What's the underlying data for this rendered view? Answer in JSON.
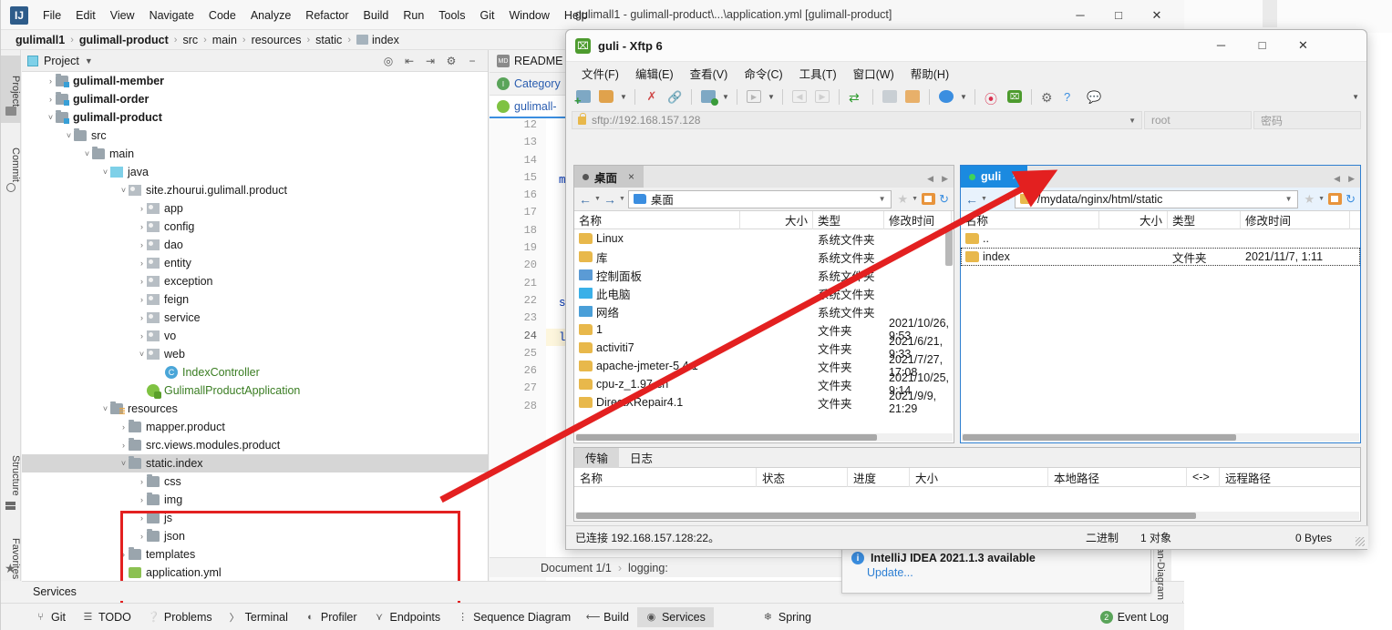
{
  "idea": {
    "title": "gulimall1 - gulimall-product\\...\\application.yml [gulimall-product]",
    "logo": "IJ",
    "window_controls": {
      "minimize": "─",
      "maximize": "□",
      "close": "✕"
    },
    "menu": [
      {
        "label": "File"
      },
      {
        "label": "Edit"
      },
      {
        "label": "View"
      },
      {
        "label": "Navigate"
      },
      {
        "label": "Code"
      },
      {
        "label": "Analyze"
      },
      {
        "label": "Refactor"
      },
      {
        "label": "Build"
      },
      {
        "label": "Run"
      },
      {
        "label": "Tools"
      },
      {
        "label": "Git"
      },
      {
        "label": "Window"
      },
      {
        "label": "Help"
      }
    ],
    "breadcrumb": [
      {
        "label": "gulimall1",
        "bold": true
      },
      {
        "label": "gulimall-product",
        "bold": true
      },
      {
        "label": "src",
        "bold": false
      },
      {
        "label": "main",
        "bold": false
      },
      {
        "label": "resources",
        "bold": false
      },
      {
        "label": "static",
        "bold": false
      },
      {
        "label": "index",
        "bold": false
      }
    ],
    "tool_strip": [
      {
        "label": "Project",
        "icon": "folder-icon"
      },
      {
        "label": "Commit",
        "icon": "commit-icon"
      },
      {
        "label": "Structure",
        "icon": "structure-icon"
      },
      {
        "label": "Favorites",
        "icon": "star-icon"
      }
    ],
    "right_strip": {
      "label": "Bean-Diagram"
    },
    "project_panel": {
      "title": "Project",
      "header_icons": [
        "target-icon",
        "expand-all-icon",
        "collapse-all-icon",
        "gear-icon",
        "hide-icon"
      ],
      "tree": [
        {
          "label": "gulimall-member",
          "indent": 1,
          "arrow": "›",
          "icon": "module-folder",
          "bold": true
        },
        {
          "label": "gulimall-order",
          "indent": 1,
          "arrow": "›",
          "icon": "module-folder",
          "bold": true
        },
        {
          "label": "gulimall-product",
          "indent": 1,
          "arrow": "˅",
          "icon": "module-folder",
          "bold": true
        },
        {
          "label": "src",
          "indent": 2,
          "arrow": "˅",
          "icon": "folder",
          "bold": false
        },
        {
          "label": "main",
          "indent": 3,
          "arrow": "˅",
          "icon": "folder",
          "bold": false
        },
        {
          "label": "java",
          "indent": 4,
          "arrow": "˅",
          "icon": "source-folder",
          "bold": false
        },
        {
          "label": "site.zhourui.gulimall.product",
          "indent": 5,
          "arrow": "˅",
          "icon": "package",
          "bold": false
        },
        {
          "label": "app",
          "indent": 6,
          "arrow": "›",
          "icon": "package",
          "bold": false
        },
        {
          "label": "config",
          "indent": 6,
          "arrow": "›",
          "icon": "package",
          "bold": false
        },
        {
          "label": "dao",
          "indent": 6,
          "arrow": "›",
          "icon": "package",
          "bold": false
        },
        {
          "label": "entity",
          "indent": 6,
          "arrow": "›",
          "icon": "package",
          "bold": false
        },
        {
          "label": "exception",
          "indent": 6,
          "arrow": "›",
          "icon": "package",
          "bold": false
        },
        {
          "label": "feign",
          "indent": 6,
          "arrow": "›",
          "icon": "package",
          "bold": false
        },
        {
          "label": "service",
          "indent": 6,
          "arrow": "›",
          "icon": "package",
          "bold": false
        },
        {
          "label": "vo",
          "indent": 6,
          "arrow": "›",
          "icon": "package",
          "bold": false
        },
        {
          "label": "web",
          "indent": 6,
          "arrow": "˅",
          "icon": "package",
          "bold": false
        },
        {
          "label": "IndexController",
          "indent": 7,
          "arrow": "",
          "icon": "class",
          "bold": false
        },
        {
          "label": "GulimallProductApplication",
          "indent": 6,
          "arrow": "",
          "icon": "spring-class",
          "bold": false
        },
        {
          "label": "resources",
          "indent": 4,
          "arrow": "˅",
          "icon": "resources-folder",
          "bold": false
        },
        {
          "label": "mapper.product",
          "indent": 5,
          "arrow": "›",
          "icon": "folder",
          "bold": false
        },
        {
          "label": "src.views.modules.product",
          "indent": 5,
          "arrow": "›",
          "icon": "folder",
          "bold": false
        },
        {
          "label": "static.index",
          "indent": 5,
          "arrow": "˅",
          "icon": "folder",
          "bold": false,
          "selected": true
        },
        {
          "label": "css",
          "indent": 6,
          "arrow": "›",
          "icon": "folder",
          "bold": false
        },
        {
          "label": "img",
          "indent": 6,
          "arrow": "›",
          "icon": "folder",
          "bold": false
        },
        {
          "label": "js",
          "indent": 6,
          "arrow": "›",
          "icon": "folder",
          "bold": false
        },
        {
          "label": "json",
          "indent": 6,
          "arrow": "›",
          "icon": "folder",
          "bold": false
        },
        {
          "label": "templates",
          "indent": 5,
          "arrow": "›",
          "icon": "folder",
          "bold": false
        },
        {
          "label": "application.yml",
          "indent": 5,
          "arrow": "",
          "icon": "yml",
          "bold": false
        }
      ]
    },
    "editor": {
      "tabs": [
        {
          "label": "README",
          "icon": "markdown-icon",
          "active": false
        },
        {
          "label": "Category",
          "icon": "interface-icon",
          "active": false
        },
        {
          "label": "gulimall-",
          "icon": "spring-icon",
          "active": true
        }
      ],
      "line_numbers": [
        "12",
        "13",
        "14",
        "15",
        "16",
        "17",
        "18",
        "19",
        "20",
        "21",
        "22",
        "23",
        "24",
        "25",
        "26",
        "27",
        "28"
      ],
      "visible_code": [
        "",
        "",
        "",
        "my",
        "",
        "",
        "",
        "",
        "",
        "",
        "se",
        "",
        "lo",
        "",
        "",
        "",
        ""
      ],
      "document_status": "Document 1/1",
      "document_path": "logging:"
    },
    "services_bar": {
      "label": "Services"
    },
    "status_bar": {
      "items": [
        {
          "label": "Git",
          "icon": "git-icon"
        },
        {
          "label": "TODO",
          "icon": "todo-icon"
        },
        {
          "label": "Problems",
          "icon": "problems-icon"
        },
        {
          "label": "Terminal",
          "icon": "terminal-icon"
        },
        {
          "label": "Profiler",
          "icon": "profiler-icon"
        },
        {
          "label": "Endpoints",
          "icon": "endpoints-icon"
        },
        {
          "label": "Sequence Diagram",
          "icon": "sequence-diagram-icon"
        },
        {
          "label": "Build",
          "icon": "build-icon"
        },
        {
          "label": "Services",
          "icon": "services-icon",
          "active": true
        },
        {
          "label": "Spring",
          "icon": "spring-leaf-icon"
        }
      ],
      "event_log": {
        "label": "Event Log",
        "count": "2"
      }
    },
    "notification": {
      "title": "IntelliJ IDEA 2021.1.3 available",
      "link": "Update...",
      "icon": "info-icon"
    }
  },
  "xftp": {
    "title": "guli - Xftp 6",
    "logo_icon": "xftp-logo-icon",
    "window_controls": {
      "minimize": "─",
      "maximize": "□",
      "close": "✕"
    },
    "menu": [
      {
        "label": "文件(F)"
      },
      {
        "label": "编辑(E)"
      },
      {
        "label": "查看(V)"
      },
      {
        "label": "命令(C)"
      },
      {
        "label": "工具(T)"
      },
      {
        "label": "窗口(W)"
      },
      {
        "label": "帮助(H)"
      }
    ],
    "toolbar_icons": [
      "new-file-icon",
      "open-folder-icon",
      "disconnect-icon",
      "link-icon",
      "session-settings-icon",
      "run-icon",
      "transfer-left-icon",
      "transfer-right-icon",
      "sync-icon",
      "copy-icon",
      "paste-icon",
      "globe-icon",
      "xshell-icon",
      "xftp-icon",
      "gear-icon",
      "help-icon",
      "chat-icon"
    ],
    "address": {
      "protocol_value": "sftp://192.168.157.128",
      "lock_icon": "lock-icon",
      "user_value": "root",
      "password_placeholder": "密码"
    },
    "left_pane": {
      "tab_label": "桌面",
      "tab_close": "×",
      "status_dot": "grey",
      "path": "桌面",
      "columns": [
        "名称",
        "大小",
        "类型",
        "修改时间"
      ],
      "rows": [
        {
          "name": "Linux",
          "size": "",
          "type": "系统文件夹",
          "modified": "",
          "icon": "folder-icon"
        },
        {
          "name": "库",
          "size": "",
          "type": "系统文件夹",
          "modified": "",
          "icon": "folder-icon"
        },
        {
          "name": "控制面板",
          "size": "",
          "type": "系统文件夹",
          "modified": "",
          "icon": "control-panel-icon"
        },
        {
          "name": "此电脑",
          "size": "",
          "type": "系统文件夹",
          "modified": "",
          "icon": "this-pc-icon"
        },
        {
          "name": "网络",
          "size": "",
          "type": "系统文件夹",
          "modified": "",
          "icon": "network-icon"
        },
        {
          "name": "1",
          "size": "",
          "type": "文件夹",
          "modified": "2021/10/26, 9:53",
          "icon": "folder-icon"
        },
        {
          "name": "activiti7",
          "size": "",
          "type": "文件夹",
          "modified": "2021/6/21, 9:33",
          "icon": "folder-icon"
        },
        {
          "name": "apache-jmeter-5.4.1",
          "size": "",
          "type": "文件夹",
          "modified": "2021/7/27, 17:08",
          "icon": "folder-icon"
        },
        {
          "name": "cpu-z_1.97-cn",
          "size": "",
          "type": "文件夹",
          "modified": "2021/10/25, 9:14",
          "icon": "folder-icon"
        },
        {
          "name": "DirectXRepair4.1",
          "size": "",
          "type": "文件夹",
          "modified": "2021/9/9, 21:29",
          "icon": "folder-icon"
        }
      ]
    },
    "right_pane": {
      "tab_label": "guli",
      "tab_close": "×",
      "status_dot": "green",
      "path": "/mydata/nginx/html/static",
      "columns": [
        "名称",
        "大小",
        "类型",
        "修改时间"
      ],
      "rows": [
        {
          "name": "..",
          "size": "",
          "type": "",
          "modified": "",
          "icon": "folder-up-icon"
        },
        {
          "name": "index",
          "size": "",
          "type": "文件夹",
          "modified": "2021/11/7, 1:11",
          "icon": "folder-icon",
          "selected": true
        }
      ]
    },
    "transfer": {
      "tabs": [
        {
          "label": "传输",
          "active": true
        },
        {
          "label": "日志",
          "active": false
        }
      ],
      "columns": [
        "名称",
        "状态",
        "进度",
        "大小",
        "本地路径",
        "<->",
        "远程路径"
      ],
      "rows": []
    },
    "status": {
      "connection": "已连接 192.168.157.128:22。",
      "mode": "二进制",
      "objects": "1 对象",
      "bytes": "0 Bytes"
    }
  },
  "annotation": {
    "arrow_color": "#e32020",
    "highlight_box_color": "#e32020"
  }
}
